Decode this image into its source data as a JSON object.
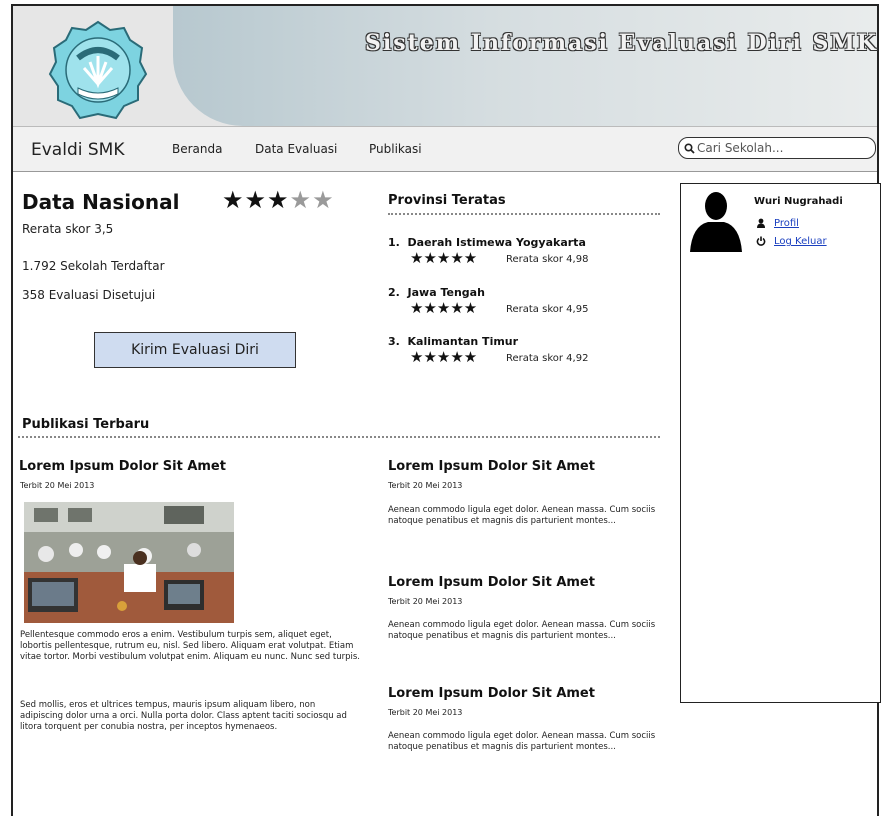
{
  "header": {
    "title": "Sistem Informasi Evaluasi Diri SMK"
  },
  "nav": {
    "brand": "Evaldi SMK",
    "items": [
      "Beranda",
      "Data Evaluasi",
      "Publikasi"
    ],
    "search_placeholder": "Cari Sekolah..."
  },
  "nasional": {
    "title": "Data Nasional",
    "rating": 3,
    "rating_max": 5,
    "score": "Rerata skor 3,5",
    "schools": "1.792 Sekolah Terdaftar",
    "evaluations": "358 Evaluasi Disetujui",
    "button": "Kirim Evaluasi Diri"
  },
  "provinsi": {
    "title": "Provinsi Teratas",
    "items": [
      {
        "num": "1.",
        "name": "Daerah Istimewa Yogyakarta",
        "score": "Rerata skor 4,98"
      },
      {
        "num": "2.",
        "name": "Jawa Tengah",
        "score": "Rerata skor 4,95"
      },
      {
        "num": "3.",
        "name": "Kalimantan Timur",
        "score": "Rerata skor 4,92"
      }
    ]
  },
  "user": {
    "name": "Wuri Nugrahadi",
    "profile": "Profil",
    "logout": "Log Keluar"
  },
  "publikasi": {
    "title": "Publikasi Terbaru",
    "main": {
      "title": "Lorem Ipsum Dolor Sit Amet",
      "date": "Terbit 20 Mei 2013",
      "p1": "Pellentesque commodo eros a enim. Vestibulum turpis sem, aliquet eget, lobortis pellentesque, rutrum eu, nisl. Sed libero. Aliquam erat volutpat. Etiam vitae tortor. Morbi vestibulum volutpat enim. Aliquam eu nunc. Nunc sed turpis.",
      "p2": "Sed mollis, eros et ultrices tempus, mauris ipsum aliquam libero, non adipiscing dolor urna a orci. Nulla porta dolor. Class aptent taciti sociosqu ad litora torquent per conubia nostra, per inceptos hymenaeos."
    },
    "items": [
      {
        "title": "Lorem Ipsum Dolor Sit Amet",
        "date": "Terbit 20 Mei 2013",
        "excerpt": "Aenean commodo ligula eget dolor. Aenean massa. Cum sociis natoque penatibus et magnis dis parturient montes..."
      },
      {
        "title": "Lorem Ipsum Dolor Sit Amet",
        "date": "Terbit 20 Mei 2013",
        "excerpt": "Aenean commodo ligula eget dolor. Aenean massa. Cum sociis natoque penatibus et magnis dis parturient montes..."
      },
      {
        "title": "Lorem Ipsum Dolor Sit Amet",
        "date": "Terbit 20 Mei 2013",
        "excerpt": "Aenean commodo ligula eget dolor. Aenean massa. Cum sociis natoque penatibus et magnis dis parturient montes..."
      }
    ]
  }
}
